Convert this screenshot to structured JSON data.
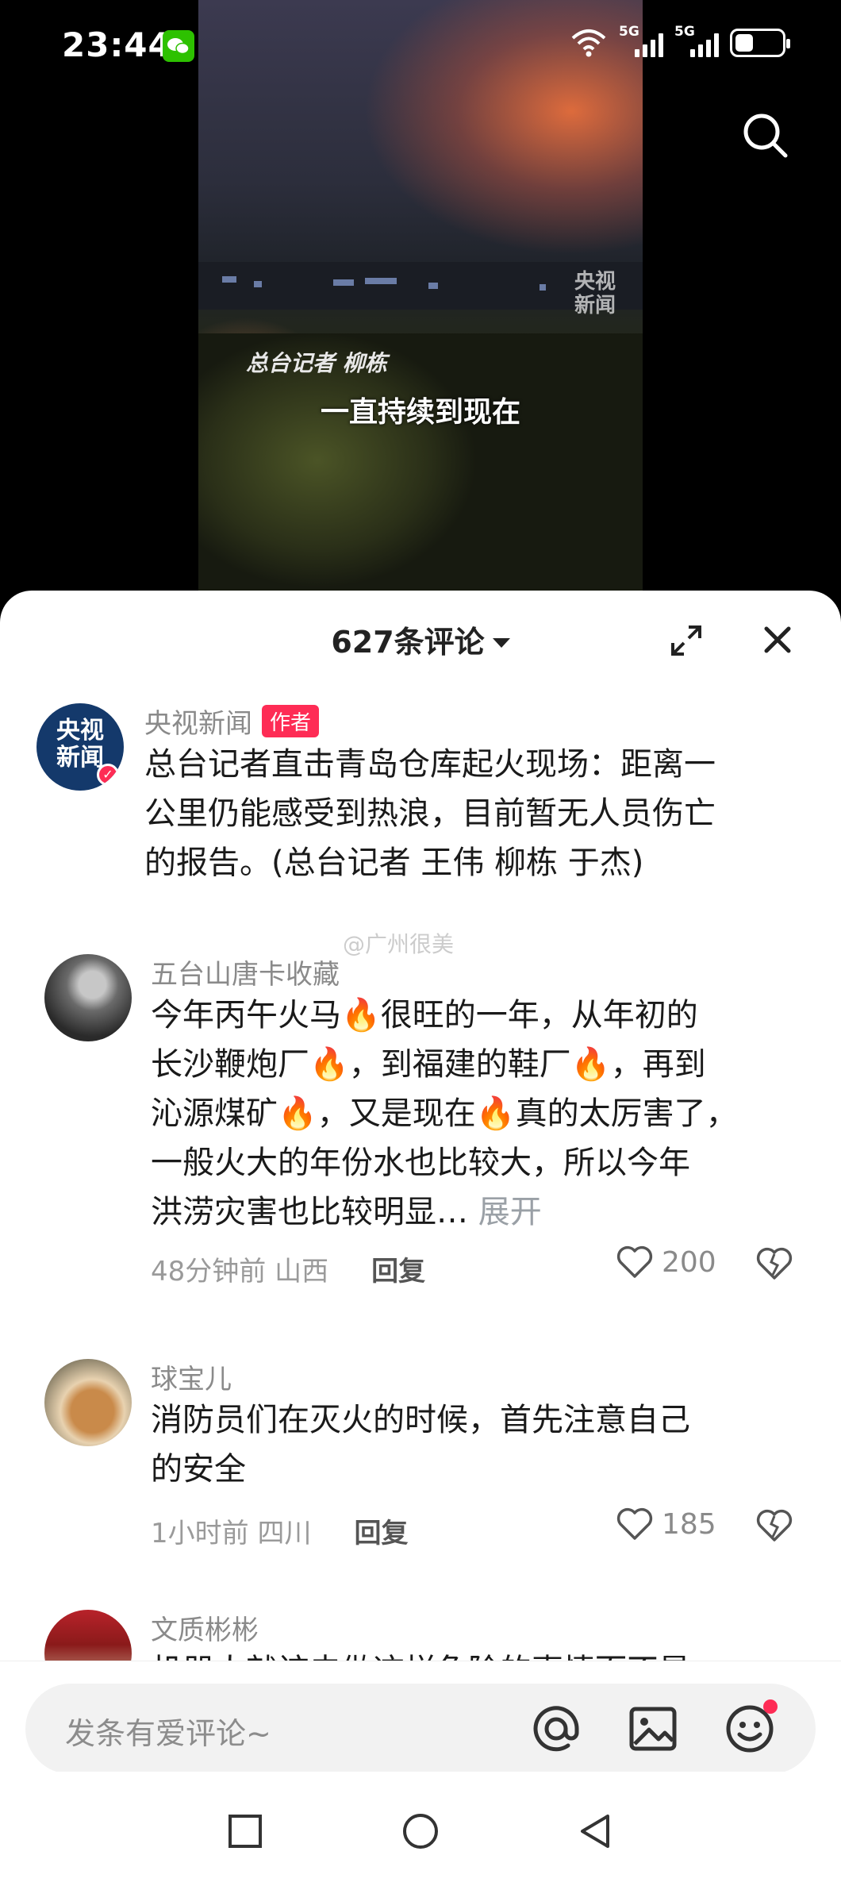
{
  "status_bar": {
    "time": "23:44",
    "network_1": "5G",
    "network_2": "5G",
    "icons": [
      "wechat-icon",
      "wifi-icon",
      "signal-icon",
      "battery-icon"
    ]
  },
  "video": {
    "watermark": "央视\n新闻",
    "reporter_caption": "总台记者 柳栋",
    "subtitle": "一直持续到现在"
  },
  "comments_sheet": {
    "title": "627条评论",
    "weibo_watermark": "@广州很美",
    "comments": [
      {
        "user": "央视新闻",
        "badge": "作者",
        "avatar_text": "央视\n新闻",
        "lines": [
          "总台记者直击青岛仓库起火现场：距离一",
          "公里仍能感受到热浪，目前暂无人员伤亡",
          "的报告。(总台记者 王伟 柳栋 于杰)"
        ]
      },
      {
        "user": "五台山唐卡收藏",
        "lines": [
          "今年丙午火马🔥很旺的一年，从年初的",
          "长沙鞭炮厂🔥，到福建的鞋厂🔥，再到",
          "沁源煤矿🔥，又是现在🔥真的太厉害了，",
          "一般火大的年份水也比较大，所以今年",
          "洪涝灾害也比较明显…"
        ],
        "more": "展开",
        "time_location": "48分钟前 山西",
        "reply": "回复",
        "likes": "200"
      },
      {
        "user": "球宝儿",
        "lines": [
          "消防员们在灭火的时候，首先注意自己",
          "的安全"
        ],
        "time_location": "1小时前 四川",
        "reply": "回复",
        "likes": "185"
      },
      {
        "user": "文质彬彬",
        "lines": [
          "机器人就该去做这样危险的事情而不是"
        ]
      }
    ]
  },
  "input_bar": {
    "placeholder": "发条有爱评论~",
    "icons": [
      "at-icon",
      "image-icon",
      "emoji-icon"
    ]
  },
  "nav_bar": {
    "icons": [
      "recent-apps-icon",
      "home-icon",
      "back-icon"
    ]
  },
  "colors": {
    "accent": "#fe2c55",
    "text_primary": "#1a1a1a",
    "text_secondary": "#8a8a8a"
  }
}
